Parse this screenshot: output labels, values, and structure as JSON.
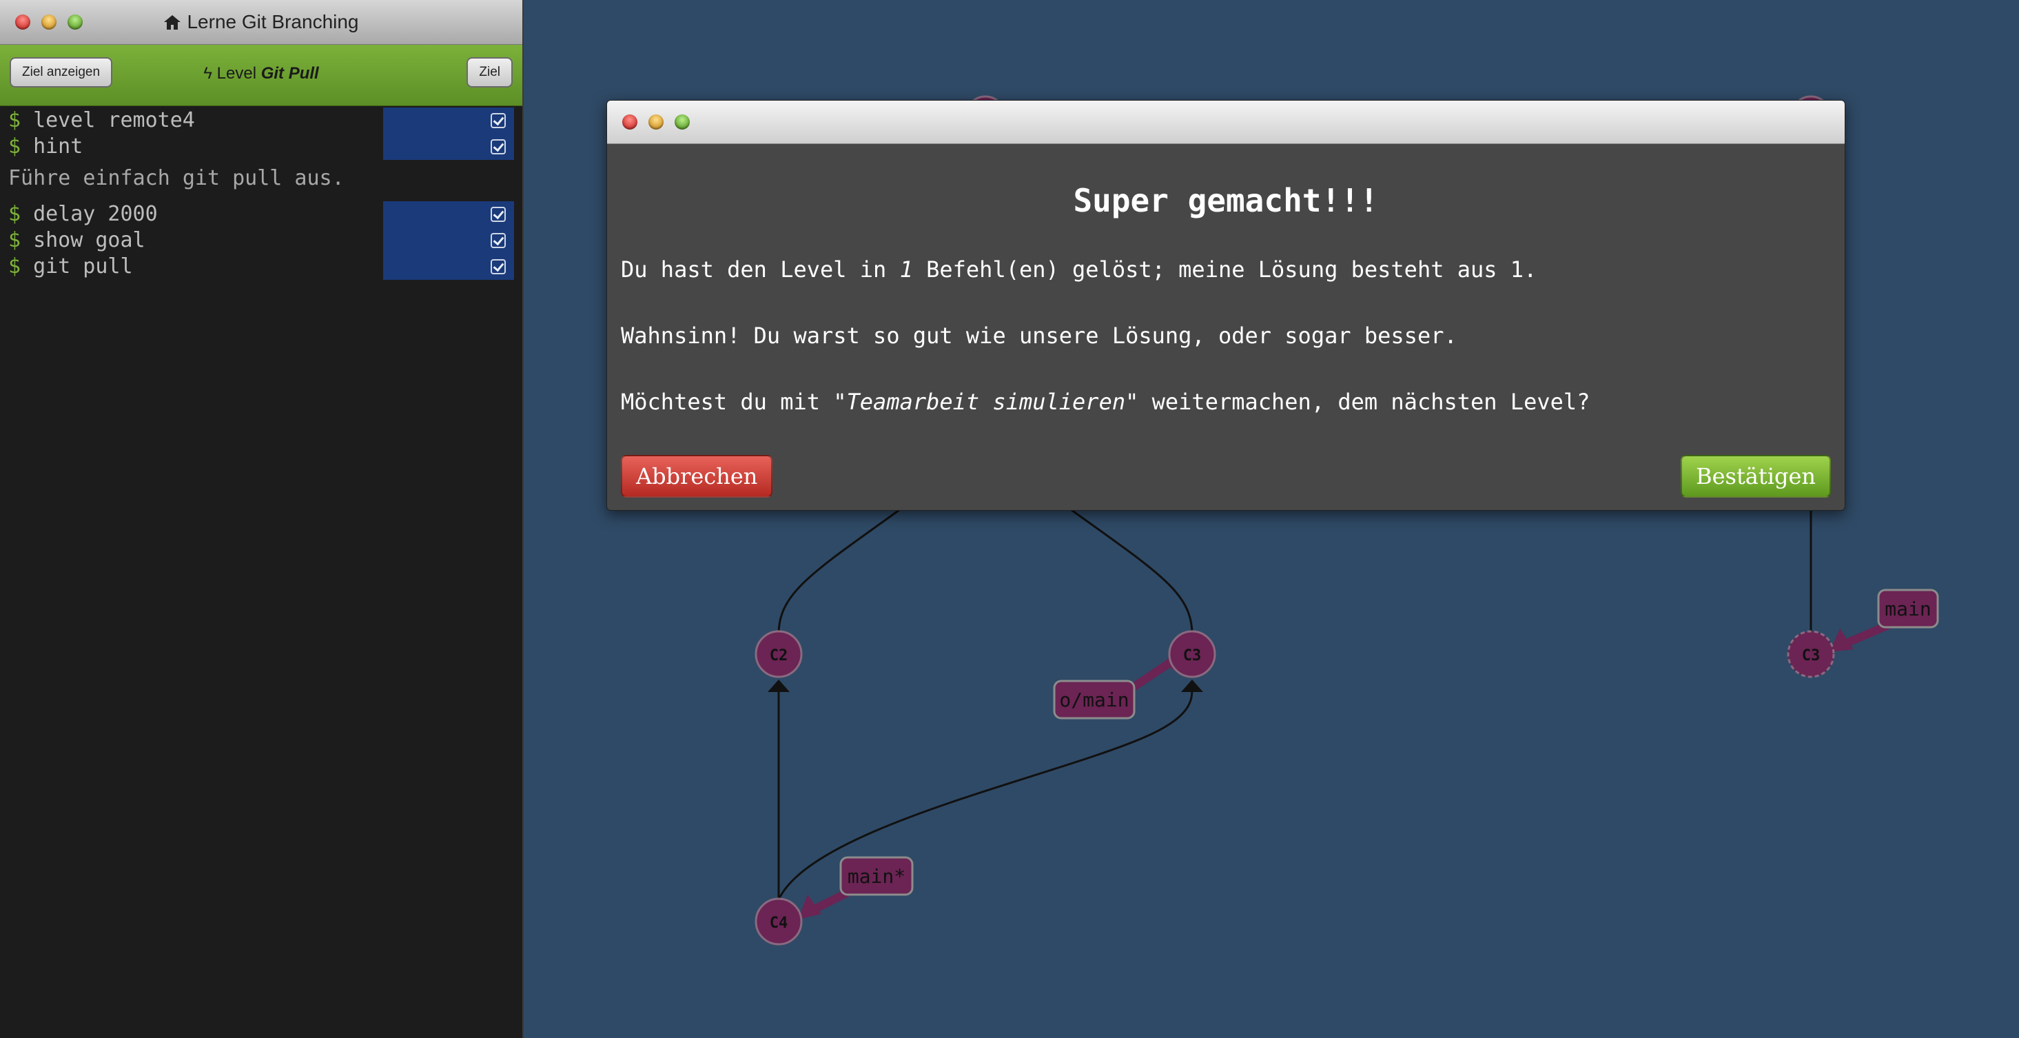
{
  "window": {
    "title": "Lerne Git Branching"
  },
  "levelbar": {
    "show_goal_label": "Ziel anzeigen",
    "level_prefix": "Level",
    "level_name": "Git Pull",
    "goal_label": "Ziel"
  },
  "terminal": {
    "prompt": "$",
    "commands_a": [
      "level remote4",
      "hint"
    ],
    "hint_text": "Führe einfach git pull aus.",
    "commands_b": [
      "delay 2000",
      "show goal",
      "git pull"
    ]
  },
  "graph": {
    "local": {
      "c2": "C2",
      "c3": "C3",
      "c4": "C4",
      "origin_branch": "o/main",
      "head_branch": "main*"
    },
    "goal": {
      "c3": "C3",
      "branch": "main"
    }
  },
  "dialog": {
    "heading": "Super gemacht!!!",
    "p1_before": "Du hast den Level in ",
    "p1_count": "1",
    "p1_after": " Befehl(en) gelöst; meine Lösung besteht aus 1.",
    "p2": "Wahnsinn! Du warst so gut wie unsere Lösung, oder sogar besser.",
    "p3_before": "Möchtest du mit \"",
    "p3_level": "Teamarbeit simulieren",
    "p3_after": "\" weitermachen, dem nächsten Level?",
    "cancel_label": "Abbrechen",
    "confirm_label": "Bestätigen"
  },
  "colors": {
    "background": "#2f4a66",
    "commit_fill": "#6b2454",
    "branch_fill": "#6b2454",
    "green": "#7cb13a",
    "cancel": "#c0392b",
    "confirm": "#6fae2c"
  }
}
